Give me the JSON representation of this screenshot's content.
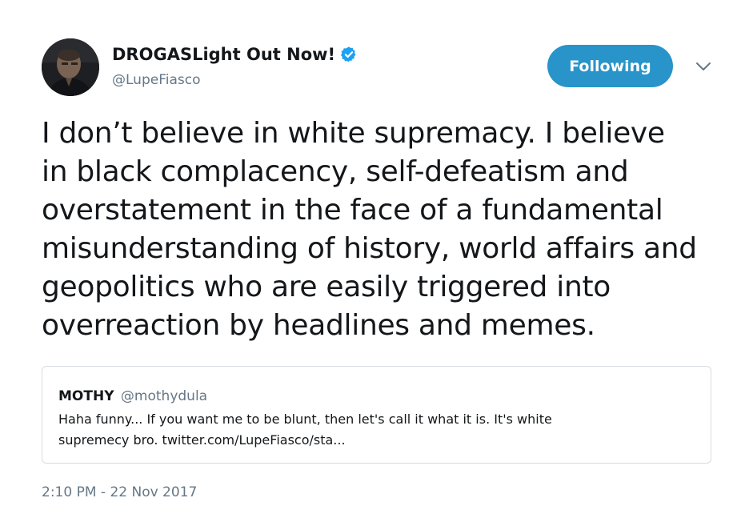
{
  "author": {
    "display_name": "DROGASLight Out Now!",
    "handle": "@LupeFiasco",
    "verified_icon": "verified-badge-icon"
  },
  "actions": {
    "follow_label": "Following",
    "caret_icon": "chevron-down-icon"
  },
  "tweet": {
    "lines": [
      "I don’t believe in white supremacy. I believe",
      "in black complacency, self-defeatism and",
      "overstatement in the face of a fundamental",
      "misunderstanding of history, world affairs and",
      "geopolitics who are easily triggered into",
      "overreaction by headlines and memes."
    ]
  },
  "quote": {
    "name": "MOTHY",
    "handle": "@mothydula",
    "lines": [
      "Haha funny... If you want me to be blunt, then let's call it what it is. It's white",
      "supremecy bro. twitter.com/LupeFiasco/sta..."
    ]
  },
  "timestamp": "2:10 PM - 22 Nov 2017",
  "colors": {
    "accent": "#2894c9",
    "text": "#14171a",
    "muted": "#657786",
    "border": "#d7dce0"
  }
}
